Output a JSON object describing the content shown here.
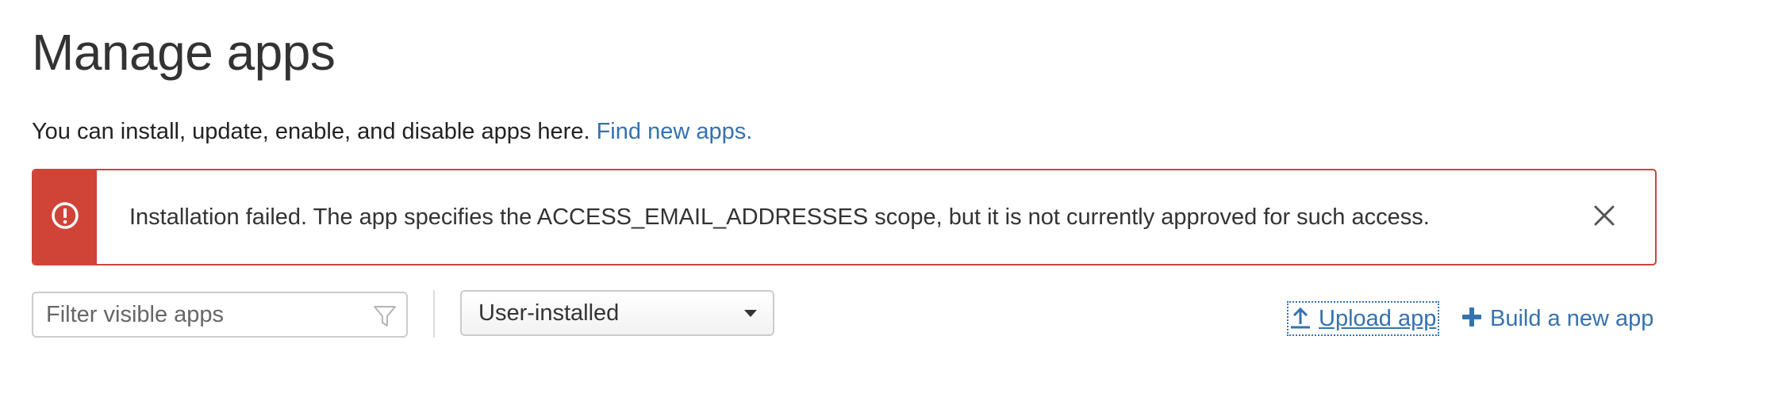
{
  "page": {
    "title": "Manage apps",
    "intro_text": "You can install, update, enable, and disable apps here.",
    "intro_link": "Find new apps."
  },
  "alert": {
    "type": "error",
    "message": "Installation failed. The app specifies the ACCESS_EMAIL_ADDRESSES scope, but it is not currently approved for such access.",
    "icon": "exclamation-circle-icon",
    "close_icon": "close-icon",
    "color": "#d04437"
  },
  "toolbar": {
    "filter_placeholder": "Filter visible apps",
    "filter_value": "",
    "filter_icon": "funnel-icon",
    "select_value": "User-installed",
    "upload_label": "Upload app",
    "upload_icon": "upload-arrow-icon",
    "build_label": "Build a new app",
    "build_icon": "plus-icon",
    "link_color": "#3572b0"
  }
}
